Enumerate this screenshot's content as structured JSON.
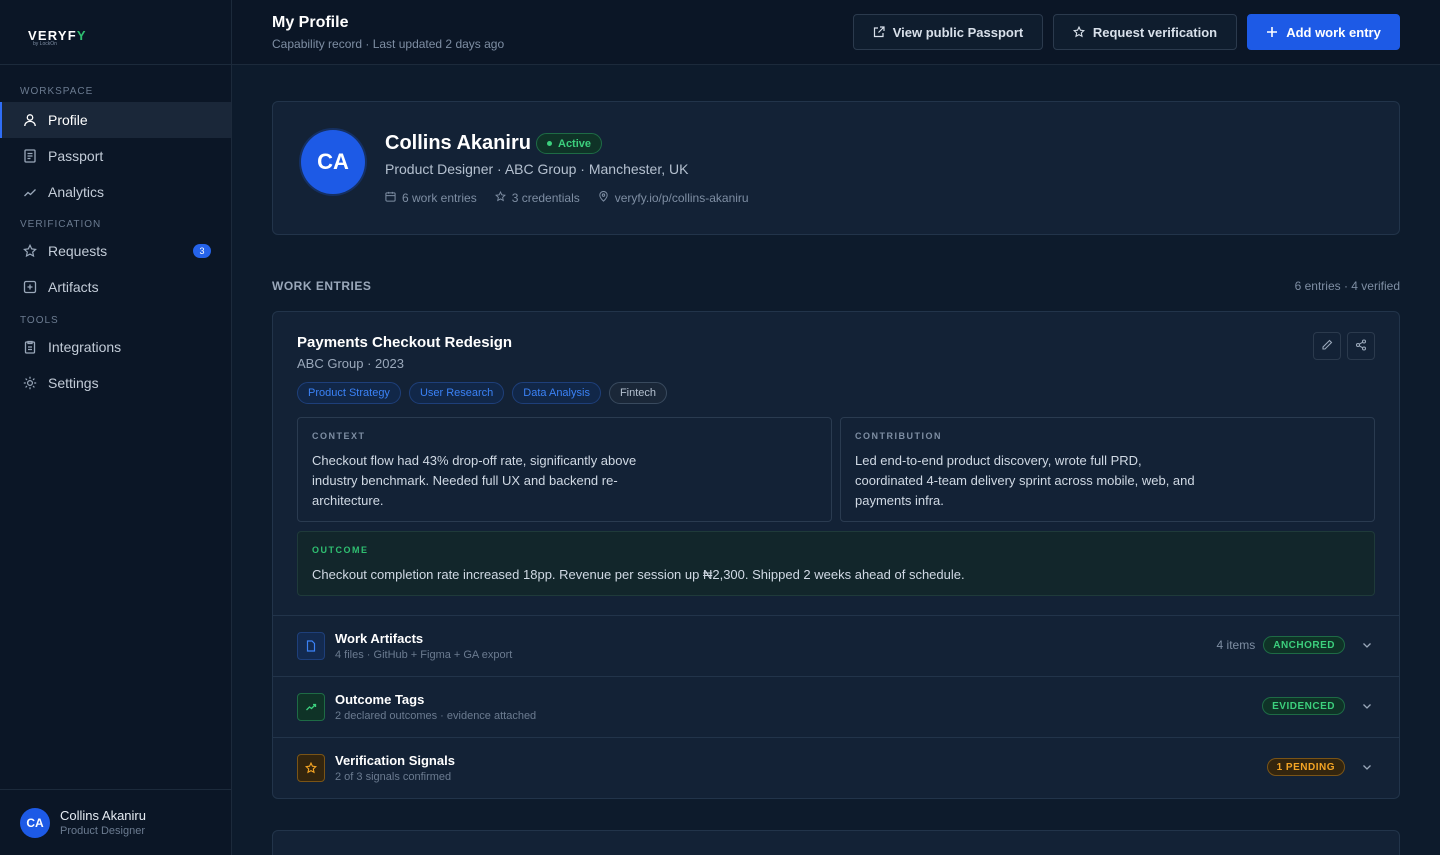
{
  "brand": {
    "logo_main": "VERYF",
    "logo_accent": "Y",
    "logo_sub": "by LockOn"
  },
  "sidebar": {
    "sections": [
      {
        "label": "WORKSPACE"
      },
      {
        "label": "VERIFICATION"
      },
      {
        "label": "TOOLS"
      }
    ],
    "items": [
      {
        "label": "Profile",
        "icon": "user-icon"
      },
      {
        "label": "Passport",
        "icon": "document-icon"
      },
      {
        "label": "Analytics",
        "icon": "trend-icon"
      },
      {
        "label": "Requests",
        "icon": "star-icon",
        "badge": "3"
      },
      {
        "label": "Artifacts",
        "icon": "plus-square-icon"
      },
      {
        "label": "Integrations",
        "icon": "clipboard-icon"
      },
      {
        "label": "Settings",
        "icon": "sun-gear-icon"
      }
    ],
    "user": {
      "initials": "CA",
      "name": "Collins Akaniru",
      "role": "Product Designer"
    }
  },
  "header": {
    "title": "My Profile",
    "subtitle": "Capability record · Last updated 2 days ago",
    "view_passport": "View public Passport",
    "request_verification": "Request verification",
    "add_entry": "Add work entry"
  },
  "profile": {
    "initials": "CA",
    "name": "Collins Akaniru",
    "status": "Active",
    "role_line": "Product Designer · ABC Group · Manchester, UK",
    "work_entries": "6 work entries",
    "credentials": "3 credentials",
    "url": "veryfy.io/p/collins-akaniru"
  },
  "work_section": {
    "title": "WORK ENTRIES",
    "count": "6 entries · 4 verified"
  },
  "entry": {
    "title": "Payments Checkout Redesign",
    "subtitle": "ABC Group · 2023",
    "tags": [
      "Product Strategy",
      "User Research",
      "Data Analysis",
      "Fintech"
    ],
    "context_label": "CONTEXT",
    "context": "Checkout flow had 43% drop-off rate, significantly above industry benchmark. Needed full UX and backend re-architecture.",
    "contribution_label": "CONTRIBUTION",
    "contribution": "Led end-to-end product discovery, wrote full PRD, coordinated 4-team delivery sprint across mobile, web, and payments infra.",
    "outcome_label": "OUTCOME",
    "outcome": "Checkout completion rate increased 18pp. Revenue per session up ₦2,300. Shipped 2 weeks ahead of schedule.",
    "rows": [
      {
        "title": "Work Artifacts",
        "sub": "4 files · GitHub + Figma + GA export",
        "count": "4 items",
        "status": "ANCHORED"
      },
      {
        "title": "Outcome Tags",
        "sub": "2 declared outcomes · evidence attached",
        "count": "",
        "status": "EVIDENCED"
      },
      {
        "title": "Verification Signals",
        "sub": "2 of 3 signals confirmed",
        "count": "",
        "status": "1 PENDING"
      }
    ]
  },
  "colors": {
    "accent": "#1d5ae6",
    "success": "#3ccf7d",
    "warning": "#f5a524",
    "bg": "#0d1b2c"
  }
}
